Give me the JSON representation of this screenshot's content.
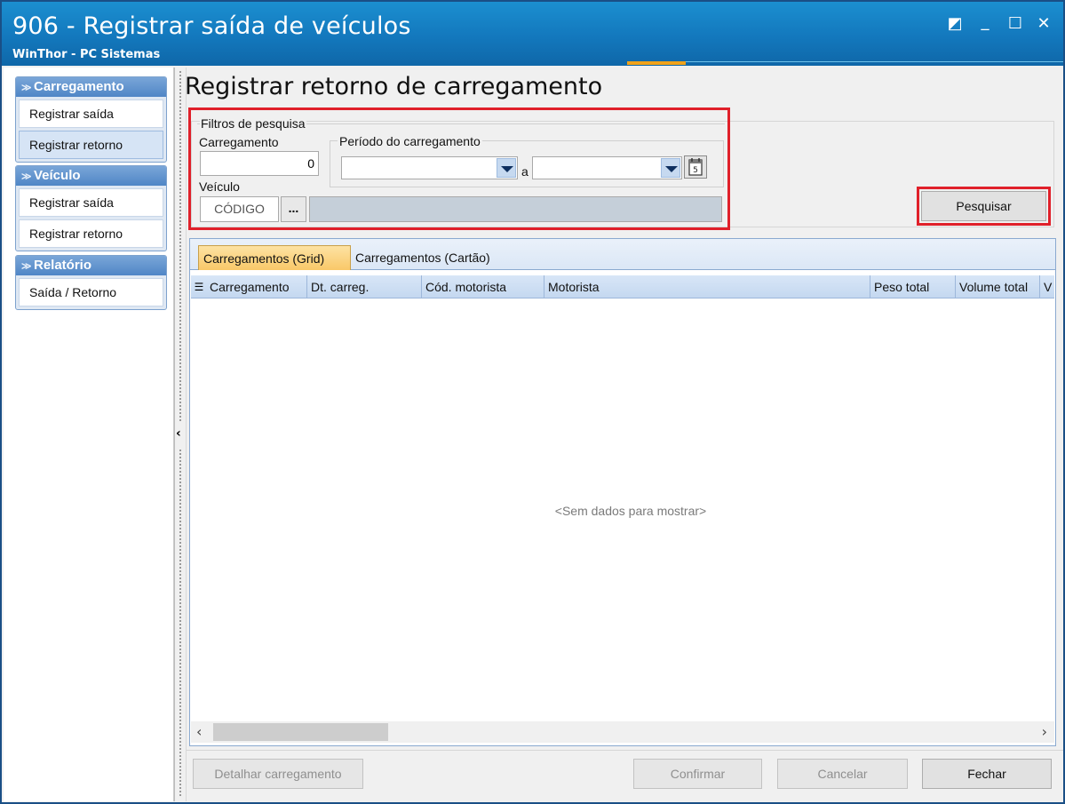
{
  "window": {
    "title": "906 - Registrar saída de veículos",
    "subtitle": "WinThor - PC Sistemas",
    "controls": {
      "restore": "◩",
      "minimize": "_",
      "maximize": "☐",
      "close": "✕"
    }
  },
  "sidebar": {
    "groups": [
      {
        "label": "Carregamento",
        "items": [
          {
            "label": "Registrar saída"
          },
          {
            "label": "Registrar retorno"
          }
        ]
      },
      {
        "label": "Veículo",
        "items": [
          {
            "label": "Registrar saída"
          },
          {
            "label": "Registrar retorno"
          }
        ]
      },
      {
        "label": "Relatório",
        "items": [
          {
            "label": "Saída / Retorno"
          }
        ]
      }
    ],
    "collapse_glyph": "‹"
  },
  "main": {
    "page_title": "Registrar retorno de carregamento",
    "filters": {
      "legend": "Filtros de pesquisa",
      "carregamento_label": "Carregamento",
      "carregamento_value": "0",
      "periodo_label": "Período do carregamento",
      "periodo_sep": "a",
      "periodo_from": "",
      "periodo_to": "",
      "veiculo_label": "Veículo",
      "veiculo_code_placeholder": "CÓDIGO",
      "veiculo_lookup": "...",
      "veiculo_name": ""
    },
    "search_button": "Pesquisar",
    "tabs": [
      {
        "label": "Carregamentos (Grid)"
      },
      {
        "label": "Carregamentos (Cartão)"
      }
    ],
    "grid": {
      "columns": [
        "Carregamento",
        "Dt. carreg.",
        "Cód. motorista",
        "Motorista",
        "Peso total",
        "Volume total",
        "V"
      ],
      "empty_message": "<Sem dados para mostrar>"
    },
    "footer": {
      "detail_button": "Detalhar carregamento",
      "confirm_button": "Confirmar",
      "cancel_button": "Cancelar",
      "close_button": "Fechar"
    }
  },
  "colors": {
    "titlebar": "#1378bd",
    "highlight": "#e0202a",
    "tab_active": "#f9c868",
    "grid_header": "#c4d8f0"
  }
}
